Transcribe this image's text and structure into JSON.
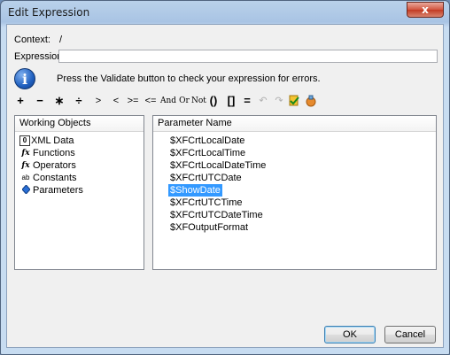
{
  "window": {
    "title": "Edit Expression",
    "close_glyph": "x"
  },
  "context": {
    "label": "Context:",
    "value": "/"
  },
  "expression": {
    "label": "Expression:",
    "value": ""
  },
  "info": {
    "message": "Press the Validate button to check your expression for errors."
  },
  "toolbar": {
    "items": [
      "+",
      "−",
      "∗",
      "÷",
      ">",
      "<",
      ">=",
      "<=",
      "And",
      "Or",
      "Not",
      "()",
      "[]",
      "="
    ]
  },
  "working_objects": {
    "header": "Working Objects",
    "items": [
      {
        "label": "XML Data",
        "icon": "xml-data-icon"
      },
      {
        "label": "Functions",
        "icon": "function-icon"
      },
      {
        "label": "Operators",
        "icon": "function-icon"
      },
      {
        "label": "Constants",
        "icon": "constants-icon"
      },
      {
        "label": "Parameters",
        "icon": "parameter-icon"
      }
    ]
  },
  "parameters": {
    "header": "Parameter Name",
    "items": [
      "$XFCrtLocalDate",
      "$XFCrtLocalTime",
      "$XFCrtLocalDateTime",
      "$XFCrtUTCDate",
      "$ShowDate",
      "$XFCrtUTCTime",
      "$XFCrtUTCDateTime",
      "$XFOutputFormat"
    ],
    "selected": "$ShowDate"
  },
  "buttons": {
    "ok": "OK",
    "cancel": "Cancel"
  },
  "colors": {
    "selection": "#3399ff",
    "close": "#c23a22"
  }
}
